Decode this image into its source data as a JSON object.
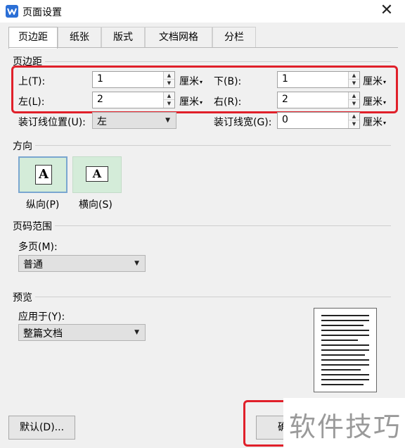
{
  "window": {
    "title": "页面设置",
    "close_symbol": "✕"
  },
  "tabs": [
    "页边距",
    "纸张",
    "版式",
    "文档网格",
    "分栏"
  ],
  "margins": {
    "section_title": "页边距",
    "top_label": "上(T):",
    "top_value": "1",
    "bottom_label": "下(B):",
    "bottom_value": "1",
    "left_label": "左(L):",
    "left_value": "2",
    "right_label": "右(R):",
    "right_value": "2",
    "unit": "厘米",
    "gutter_pos_label": "装订线位置(U):",
    "gutter_pos_value": "左",
    "gutter_width_label": "装订线宽(G):",
    "gutter_width_value": "0"
  },
  "orientation": {
    "section_title": "方向",
    "portrait_label": "纵向(P)",
    "landscape_label": "横向(S)",
    "icon_letter": "A"
  },
  "page_range": {
    "section_title": "页码范围",
    "multi_label": "多页(M):",
    "multi_value": "普通"
  },
  "preview": {
    "section_title": "预览",
    "apply_label": "应用于(Y):",
    "apply_value": "整篇文档"
  },
  "buttons": {
    "default_label": "默认(D)...",
    "ok_label_partial": "确"
  },
  "watermark": "软件技巧",
  "colors": {
    "highlight_box": "#e0202a",
    "orientation_bg": "#d4ecd9",
    "selected_border": "#7aa6d0",
    "app_icon": "#2b6fd6"
  }
}
